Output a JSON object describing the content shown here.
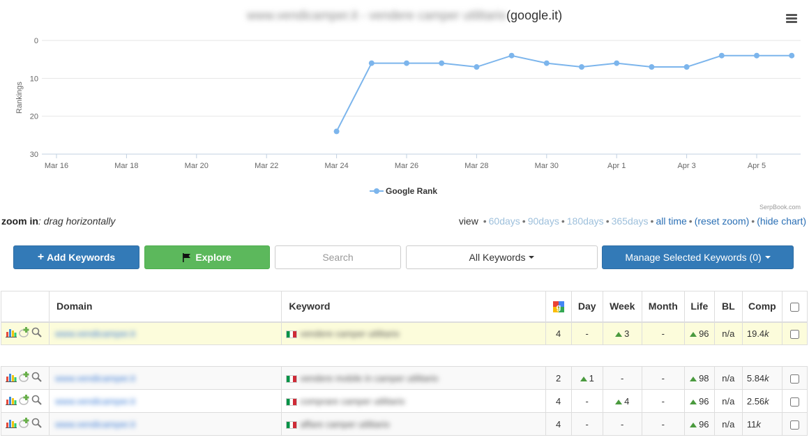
{
  "chart": {
    "title_blurred": "www.vendicamper.it - vendere camper utilitario",
    "title_suffix": "(google.it)",
    "credit": "SerpBook.com"
  },
  "chart_data": {
    "type": "line",
    "title": "(google.it)",
    "ylabel": "Rankings",
    "ylim": [
      0,
      30
    ],
    "y_reversed": true,
    "y_ticks": [
      "0",
      "10",
      "20",
      "30"
    ],
    "x_ticks": [
      "Mar 16",
      "Mar 18",
      "Mar 20",
      "Mar 22",
      "Mar 24",
      "Mar 26",
      "Mar 28",
      "Mar 30",
      "Apr 1",
      "Apr 3",
      "Apr 5"
    ],
    "grid": true,
    "legend": "bottom-center",
    "series": [
      {
        "name": "Google Rank",
        "color": "#7cb5ec",
        "points": [
          {
            "x": "Mar 24",
            "y": 24
          },
          {
            "x": "Mar 25",
            "y": 6
          },
          {
            "x": "Mar 26",
            "y": 6
          },
          {
            "x": "Mar 27",
            "y": 6
          },
          {
            "x": "Mar 28",
            "y": 7
          },
          {
            "x": "Mar 29",
            "y": 4
          },
          {
            "x": "Mar 30",
            "y": 6
          },
          {
            "x": "Mar 31",
            "y": 7
          },
          {
            "x": "Apr 1",
            "y": 6
          },
          {
            "x": "Apr 2",
            "y": 7
          },
          {
            "x": "Apr 3",
            "y": 7
          },
          {
            "x": "Apr 4",
            "y": 4
          },
          {
            "x": "Apr 5",
            "y": 4
          },
          {
            "x": "Apr 6",
            "y": 4
          }
        ]
      }
    ]
  },
  "zoom": {
    "label_bold": "zoom in",
    "label_rest": ": drag horizontally",
    "view_label": "view",
    "options": [
      {
        "label": "60days",
        "active": false
      },
      {
        "label": "90days",
        "active": false
      },
      {
        "label": "180days",
        "active": false
      },
      {
        "label": "365days",
        "active": false
      },
      {
        "label": "all time",
        "active": true
      },
      {
        "label": "(reset zoom)",
        "active": true
      },
      {
        "label": "(hide chart)",
        "active": true
      }
    ]
  },
  "toolbar": {
    "add_label": "Add Keywords",
    "explore_label": "Explore",
    "search_placeholder": "Search",
    "filter_label": "All Keywords",
    "manage_label": "Manage Selected Keywords (0)"
  },
  "table": {
    "headers": {
      "domain": "Domain",
      "keyword": "Keyword",
      "day": "Day",
      "week": "Week",
      "month": "Month",
      "life": "Life",
      "bl": "BL",
      "comp": "Comp"
    },
    "rows": [
      {
        "domain": "www.vendicamper.it",
        "keyword": "vendere camper utilitario",
        "rank": "4",
        "day": "-",
        "day_up": false,
        "week": "3",
        "week_up": true,
        "month": "-",
        "month_up": false,
        "life": "96",
        "life_up": true,
        "bl": "n/a",
        "comp": "19.4",
        "comp_unit": "k"
      },
      {
        "domain": "www.vendicamper.it",
        "keyword": "vendere mobile in camper utilitario",
        "rank": "2",
        "day": "1",
        "day_up": true,
        "week": "-",
        "week_up": false,
        "month": "-",
        "month_up": false,
        "life": "98",
        "life_up": true,
        "bl": "n/a",
        "comp": "5.84",
        "comp_unit": "k"
      },
      {
        "domain": "www.vendicamper.it",
        "keyword": "comprare camper utilitario",
        "rank": "4",
        "day": "-",
        "day_up": false,
        "week": "4",
        "week_up": true,
        "month": "-",
        "month_up": false,
        "life": "96",
        "life_up": true,
        "bl": "n/a",
        "comp": "2.56",
        "comp_unit": "k"
      },
      {
        "domain": "www.vendicamper.it",
        "keyword": "affare camper utilitario",
        "rank": "4",
        "day": "-",
        "day_up": false,
        "week": "-",
        "week_up": false,
        "month": "-",
        "month_up": false,
        "life": "96",
        "life_up": true,
        "bl": "n/a",
        "comp": "11",
        "comp_unit": "k"
      }
    ]
  }
}
